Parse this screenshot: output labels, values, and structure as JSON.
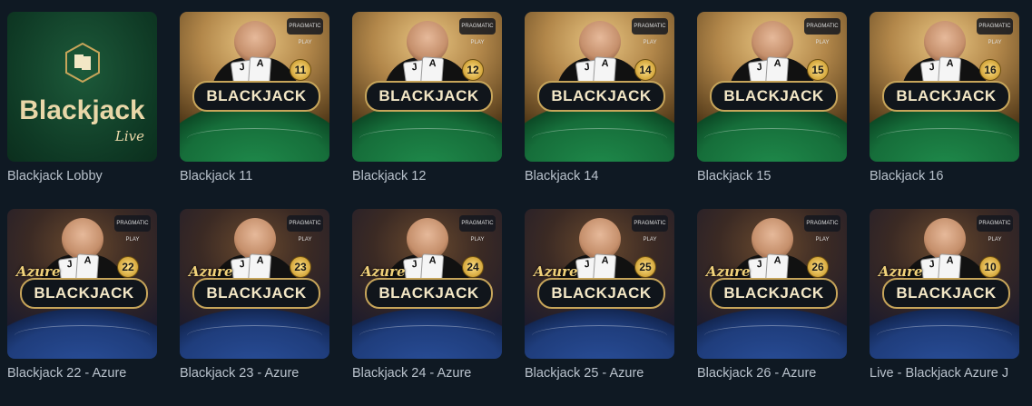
{
  "rows": [
    {
      "tiles": [
        {
          "name": "Blackjack Lobby",
          "type": "lobby",
          "logo_title": "Blackjack",
          "logo_sub": "Live"
        },
        {
          "name": "Blackjack 11",
          "type": "green",
          "table_number": "11",
          "logo": "BLACKJACK",
          "provider": "PRAGMATIC PLAY"
        },
        {
          "name": "Blackjack 12",
          "type": "green",
          "table_number": "12",
          "logo": "BLACKJACK",
          "provider": "PRAGMATIC PLAY"
        },
        {
          "name": "Blackjack 14",
          "type": "green",
          "table_number": "14",
          "logo": "BLACKJACK",
          "provider": "PRAGMATIC PLAY"
        },
        {
          "name": "Blackjack 15",
          "type": "green",
          "table_number": "15",
          "logo": "BLACKJACK",
          "provider": "PRAGMATIC PLAY"
        },
        {
          "name": "Blackjack 16",
          "type": "green",
          "table_number": "16",
          "logo": "BLACKJACK",
          "provider": "PRAGMATIC PLAY"
        }
      ]
    },
    {
      "tiles": [
        {
          "name": "Blackjack 22 - Azure",
          "type": "blue",
          "table_number": "22",
          "logo": "BLACKJACK",
          "azure": "Azure",
          "provider": "PRAGMATIC PLAY"
        },
        {
          "name": "Blackjack 23 - Azure",
          "type": "blue",
          "table_number": "23",
          "logo": "BLACKJACK",
          "azure": "Azure",
          "provider": "PRAGMATIC PLAY"
        },
        {
          "name": "Blackjack 24 - Azure",
          "type": "blue",
          "table_number": "24",
          "logo": "BLACKJACK",
          "azure": "Azure",
          "provider": "PRAGMATIC PLAY"
        },
        {
          "name": "Blackjack 25 - Azure",
          "type": "blue",
          "table_number": "25",
          "logo": "BLACKJACK",
          "azure": "Azure",
          "provider": "PRAGMATIC PLAY"
        },
        {
          "name": "Blackjack 26 - Azure",
          "type": "blue",
          "table_number": "26",
          "logo": "BLACKJACK",
          "azure": "Azure",
          "provider": "PRAGMATIC PLAY"
        },
        {
          "name": "Live - Blackjack Azure J",
          "type": "blue",
          "table_number": "10",
          "logo": "BLACKJACK",
          "azure": "Azure",
          "provider": "PRAGMATIC PLAY"
        }
      ]
    }
  ],
  "cards": [
    "J",
    "A"
  ],
  "colors": {
    "background": "#0f1923",
    "label": "#b9c2cc",
    "gold": "#c7a55a"
  }
}
